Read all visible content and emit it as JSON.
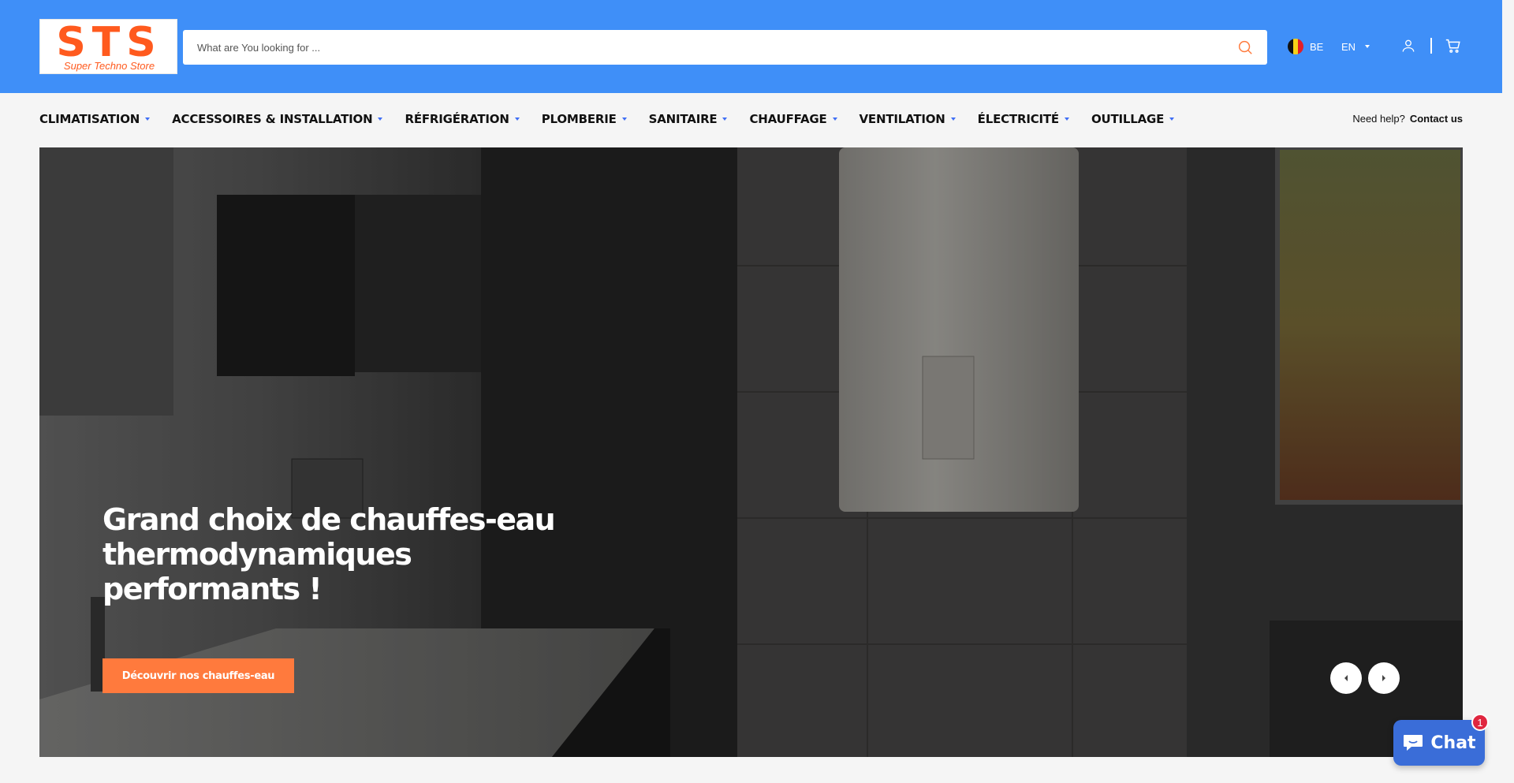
{
  "header": {
    "logo_mark": "STS",
    "logo_subtitle": "Super Techno Store",
    "search_placeholder": "What are You looking for ...",
    "country_code": "BE",
    "language": "EN",
    "colors": {
      "bar": "#3f8ff8",
      "brand_orange": "#ff5a1e"
    }
  },
  "nav": {
    "items": [
      {
        "label": "CLIMATISATION"
      },
      {
        "label": "ACCESSOIRES & INSTALLATION"
      },
      {
        "label": "RÉFRIGÉRATION"
      },
      {
        "label": "PLOMBERIE"
      },
      {
        "label": "SANITAIRE"
      },
      {
        "label": "CHAUFFAGE"
      },
      {
        "label": "VENTILATION"
      },
      {
        "label": "ÉLECTRICITÉ"
      },
      {
        "label": "OUTILLAGE"
      }
    ],
    "help_text": "Need help?",
    "help_link": "Contact us"
  },
  "hero": {
    "title": "Grand choix de chauffes-eau thermodynamiques performants !",
    "cta": "Découvrir nos chauffes-eau",
    "cta_color": "#ff7a3d"
  },
  "chat": {
    "label": "Chat",
    "badge": "1",
    "color": "#3a6dd8"
  },
  "icons": [
    "search-icon",
    "user-icon",
    "cart-icon",
    "chat-bubble-icon",
    "belgium-flag-icon",
    "chevron-left-icon",
    "chevron-right-icon"
  ]
}
